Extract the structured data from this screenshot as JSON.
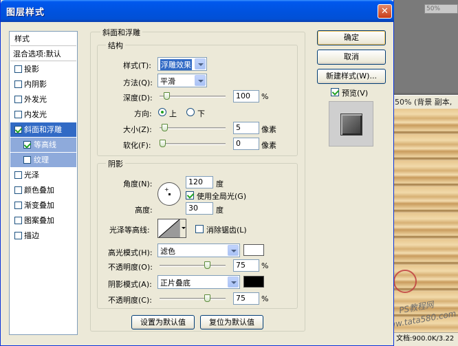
{
  "window": {
    "title": "图层样式",
    "close_glyph": "✕"
  },
  "background": {
    "zoom_field": "50%",
    "doc_title": "50% (背景 副本,",
    "status": "文档:900.0K/3.22",
    "watermark": {
      "site_name": "PS教程网",
      "url": "www.tata580.com"
    }
  },
  "style_list": {
    "header": "样式",
    "blending": "混合选项:默认",
    "items": [
      {
        "label": "投影",
        "checked": false
      },
      {
        "label": "内阴影",
        "checked": false
      },
      {
        "label": "外发光",
        "checked": false
      },
      {
        "label": "内发光",
        "checked": false
      },
      {
        "label": "斜面和浮雕",
        "checked": true
      },
      {
        "label": "等高线",
        "checked": true
      },
      {
        "label": "纹理",
        "checked": false
      },
      {
        "label": "光泽",
        "checked": false
      },
      {
        "label": "颜色叠加",
        "checked": false
      },
      {
        "label": "渐变叠加",
        "checked": false
      },
      {
        "label": "图案叠加",
        "checked": false
      },
      {
        "label": "描边",
        "checked": false
      }
    ]
  },
  "bevel": {
    "title": "斜面和浮雕",
    "structure": {
      "title": "结构",
      "style_label": "样式(T):",
      "style_value": "浮雕效果",
      "technique_label": "方法(Q):",
      "technique_value": "平滑",
      "depth_label": "深度(D):",
      "depth_value": "100",
      "depth_unit": "%",
      "depth_slider": 0.07,
      "direction_label": "方向:",
      "direction_up": "上",
      "direction_down": "下",
      "size_label": "大小(Z):",
      "size_value": "5",
      "size_unit": "像素",
      "size_slider": 0.03,
      "soften_label": "软化(F):",
      "soften_value": "0",
      "soften_unit": "像素",
      "soften_slider": 0.0
    },
    "shading": {
      "title": "阴影",
      "angle_label": "角度(N):",
      "angle_value": "120",
      "angle_unit": "度",
      "global_light_label": "使用全局光(G)",
      "altitude_label": "高度:",
      "altitude_value": "30",
      "altitude_unit": "度",
      "gloss_contour_label": "光泽等高线:",
      "antialias_label": "消除锯齿(L)",
      "highlight_mode_label": "高光模式(H):",
      "highlight_mode_value": "滤色",
      "highlight_color": "#ffffff",
      "highlight_opacity_label": "不透明度(O):",
      "highlight_opacity_value": "75",
      "highlight_opacity_unit": "%",
      "highlight_opacity_slider": 0.75,
      "shadow_mode_label": "阴影模式(A):",
      "shadow_mode_value": "正片叠底",
      "shadow_color": "#000000",
      "shadow_opacity_label": "不透明度(C):",
      "shadow_opacity_value": "75",
      "shadow_opacity_unit": "%",
      "shadow_opacity_slider": 0.75
    },
    "make_default": "设置为默认值",
    "reset_default": "复位为默认值"
  },
  "buttons": {
    "ok": "确定",
    "cancel": "取消",
    "new_style": "新建样式(W)...",
    "preview_label": "预览(V)"
  }
}
